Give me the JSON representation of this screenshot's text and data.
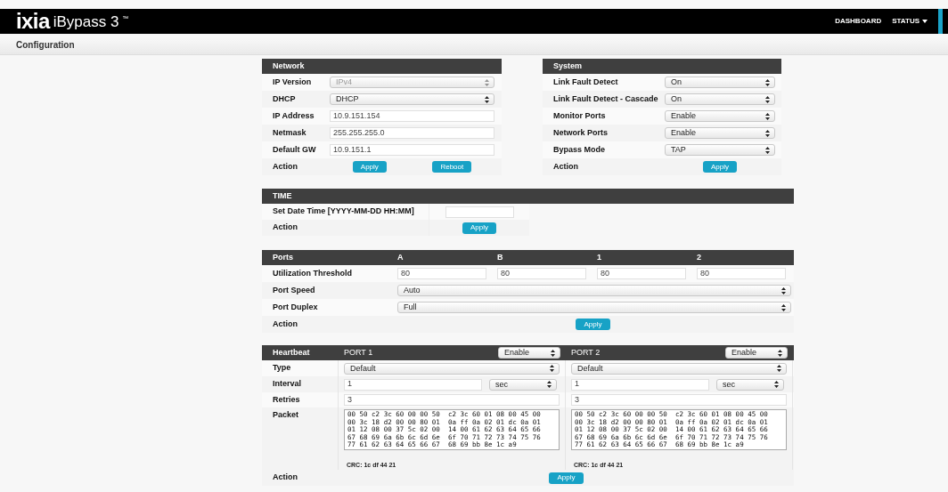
{
  "header": {
    "logo": "ixia",
    "product": "iBypass 3",
    "trademark": "™",
    "nav": [
      {
        "label": "DASHBOARD",
        "kind": "link"
      },
      {
        "label": "STATUS",
        "kind": "menu"
      }
    ]
  },
  "page_title": "Configuration",
  "network": {
    "title": "Network",
    "rows": [
      {
        "label": "IP Version",
        "kind": "select",
        "value": "IPv4",
        "disabled": true
      },
      {
        "label": "DHCP",
        "kind": "select",
        "value": "DHCP",
        "disabled": false
      },
      {
        "label": "IP Address",
        "kind": "input",
        "value": "10.9.151.154"
      },
      {
        "label": "Netmask",
        "kind": "input",
        "value": "255.255.255.0"
      },
      {
        "label": "Default GW",
        "kind": "input",
        "value": "10.9.151.1"
      },
      {
        "label": "Action",
        "kind": "buttons",
        "buttons": [
          "Apply",
          "Reboot"
        ]
      }
    ]
  },
  "system": {
    "title": "System",
    "rows": [
      {
        "label": "Link Fault Detect",
        "kind": "select",
        "value": "On",
        "disabled": false
      },
      {
        "label": "Link Fault Detect - Cascade",
        "kind": "select",
        "value": "On",
        "disabled": false
      },
      {
        "label": "Monitor Ports",
        "kind": "select",
        "value": "Enable",
        "disabled": false
      },
      {
        "label": "Network Ports",
        "kind": "select",
        "value": "Enable",
        "disabled": false
      },
      {
        "label": "Bypass Mode",
        "kind": "select",
        "value": "TAP",
        "disabled": false
      },
      {
        "label": "Action",
        "kind": "buttons",
        "buttons": [
          "Apply"
        ]
      }
    ]
  },
  "time": {
    "title": "TIME",
    "rows": [
      {
        "label": "Set Date Time [YYYY-MM-DD HH:MM]",
        "kind": "input"
      },
      {
        "label": "Action",
        "kind": "buttons",
        "buttons": [
          "Apply"
        ]
      }
    ]
  },
  "ports": {
    "title": "Ports",
    "columns": [
      "A",
      "B",
      "1",
      "2"
    ],
    "rows": [
      {
        "label": "Utilization Threshold",
        "kind": "inputs",
        "values": [
          "80",
          "80",
          "80",
          "80"
        ]
      },
      {
        "label": "Port Speed",
        "kind": "select",
        "value": "Auto"
      },
      {
        "label": "Port Duplex",
        "kind": "select",
        "value": "Full"
      },
      {
        "label": "Action",
        "kind": "buttons",
        "buttons": [
          "Apply"
        ]
      }
    ]
  },
  "heartbeat": {
    "title": "Heartbeat",
    "row_labels": [
      "Type",
      "Interval",
      "Retries",
      "Packet"
    ],
    "action_label": "Action",
    "button": "Apply",
    "ports": [
      {
        "name": "PORT 1",
        "state": "Enable",
        "type": "Default",
        "interval": "1",
        "interval_unit": "sec",
        "retries": "3",
        "packet": "00 50 c2 3c 60 00 00 50  c2 3c 60 01 08 00 45 00\n00 3c 18 d2 00 00 80 01  0a ff 0a 02 01 dc 0a 01\n01 12 08 00 37 5c 02 00  14 00 61 62 63 64 65 66\n67 68 69 6a 6b 6c 6d 6e  6f 70 71 72 73 74 75 76\n77 61 62 63 64 65 66 67  68 69 bb 8e 1c a9",
        "crc": "CRC: 1c df 44 21"
      },
      {
        "name": "PORT 2",
        "state": "Enable",
        "type": "Default",
        "interval": "1",
        "interval_unit": "sec",
        "retries": "3",
        "packet": "00 50 c2 3c 60 00 00 50  c2 3c 60 01 08 00 45 00\n00 3c 18 d2 00 00 80 01  0a ff 0a 02 01 dc 0a 01\n01 12 08 00 37 5c 02 00  14 00 61 62 63 64 65 66\n67 68 69 6a 6b 6c 6d 6e  6f 70 71 72 73 74 75 76\n77 61 62 63 64 65 66 67  68 69 bb 8e 1c a9",
        "crc": "CRC: 1c df 44 21"
      }
    ]
  }
}
